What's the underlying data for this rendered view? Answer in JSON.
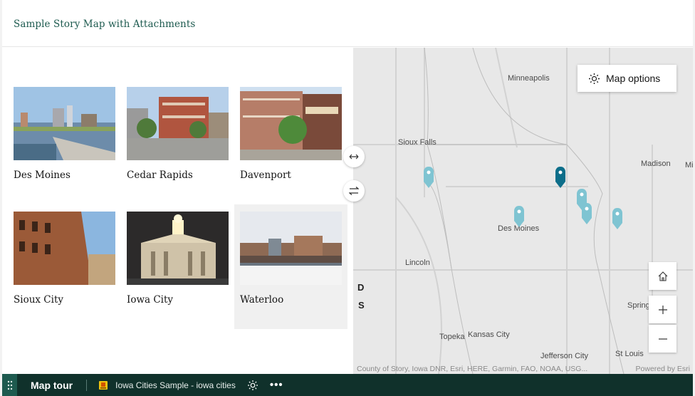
{
  "header": {
    "title": "Sample Story Map with Attachments"
  },
  "gallery": {
    "cards": [
      {
        "label": "Des Moines",
        "image": "des-moines-photo"
      },
      {
        "label": "Cedar Rapids",
        "image": "cedar-rapids-photo"
      },
      {
        "label": "Davenport",
        "image": "davenport-photo"
      },
      {
        "label": "Sioux City",
        "image": "sioux-city-photo"
      },
      {
        "label": "Iowa City",
        "image": "iowa-city-photo"
      },
      {
        "label": "Waterloo",
        "image": "waterloo-photo",
        "selected": true
      }
    ]
  },
  "side_buttons": {
    "expand_icon": "expand-horizontal-icon",
    "swap_icon": "swap-panels-icon"
  },
  "map": {
    "options_label": "Map options",
    "cities": [
      "Minneapolis",
      "Sioux Falls",
      "Madison",
      "Mi",
      "Des Moines",
      "Lincoln",
      "Spring",
      "Kansas City",
      "Topeka",
      "Jefferson City",
      "St Louis"
    ],
    "edge_letters": [
      "D",
      "S"
    ],
    "attribution": "County of Story, Iowa DNR, Esri, HERE, Garmin, FAO, NOAA, USG...",
    "powered_by": "Powered by Esri",
    "pin_color": "#7fc4d2",
    "active_pin_color": "#0d6e8a",
    "controls": [
      "home-icon",
      "zoom-in-icon",
      "zoom-out-icon"
    ]
  },
  "footer": {
    "title": "Map tour",
    "app_name": "Iowa Cities Sample - iowa cities",
    "more": "•••"
  },
  "colors": {
    "title_green": "#1d5a4f",
    "footer_bg": "#10312b",
    "grip_bg": "#1e5a4f"
  }
}
